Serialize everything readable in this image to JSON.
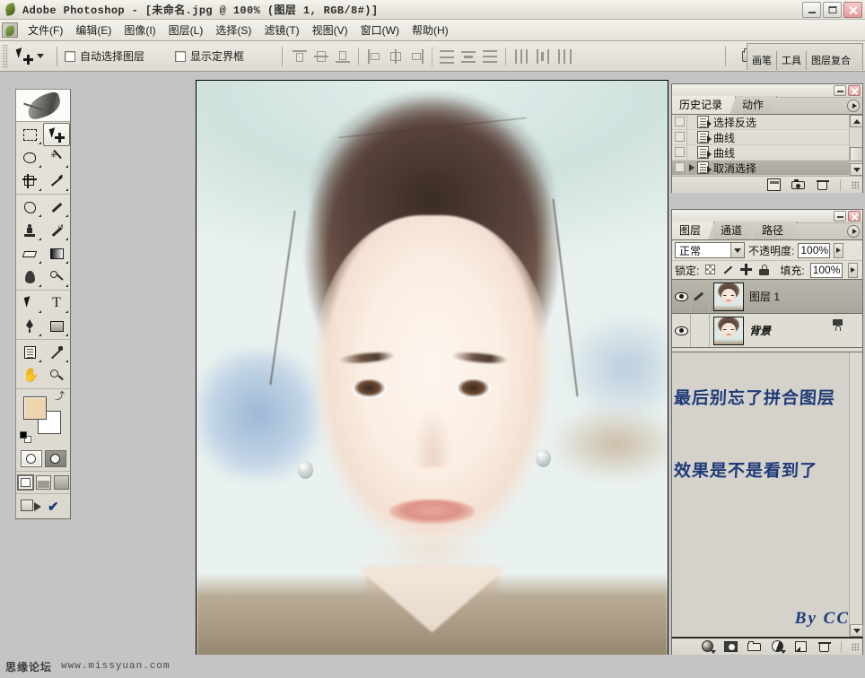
{
  "window": {
    "title": "Adobe Photoshop - [未命名.jpg @ 100% (图层 1, RGB/8#)]",
    "app_icon": "photoshop-feather-icon",
    "minimize_label": "最小化",
    "restore_label": "还原",
    "close_label": "关闭"
  },
  "menubar": {
    "doc_icon": "document-icon",
    "items": [
      {
        "label": "文件(F)"
      },
      {
        "label": "编辑(E)"
      },
      {
        "label": "图像(I)"
      },
      {
        "label": "图层(L)"
      },
      {
        "label": "选择(S)"
      },
      {
        "label": "滤镜(T)"
      },
      {
        "label": "视图(V)"
      },
      {
        "label": "窗口(W)"
      },
      {
        "label": "帮助(H)"
      }
    ]
  },
  "options_bar": {
    "tool_icon": "move-tool-icon",
    "checkboxes": [
      {
        "label": "自动选择图层",
        "checked": false
      },
      {
        "label": "显示定界框",
        "checked": false
      }
    ],
    "align_groups": [
      [
        "align-top-edges",
        "align-vertical-centers",
        "align-bottom-edges"
      ],
      [
        "align-left-edges",
        "align-horizontal-centers",
        "align-right-edges"
      ],
      [
        "distribute-top-edges",
        "distribute-vertical-centers",
        "distribute-bottom-edges"
      ],
      [
        "distribute-left-edges",
        "distribute-horizontal-centers",
        "distribute-right-edges"
      ]
    ],
    "file_browser_icon": "file-browser-icon",
    "palette_well": [
      {
        "label": "画笔"
      },
      {
        "label": "工具"
      },
      {
        "label": "图层复合"
      }
    ]
  },
  "toolbox": {
    "logo": "feather-logo",
    "tools": [
      {
        "name": "marquee-tool",
        "active": false
      },
      {
        "name": "move-tool",
        "active": true
      },
      {
        "name": "lasso-tool",
        "active": false
      },
      {
        "name": "magic-wand-tool",
        "active": false
      },
      {
        "name": "crop-tool",
        "active": false
      },
      {
        "name": "slice-tool",
        "active": false
      },
      {
        "name": "healing-brush-tool",
        "active": false
      },
      {
        "name": "brush-tool",
        "active": false
      },
      {
        "name": "clone-stamp-tool",
        "active": false
      },
      {
        "name": "history-brush-tool",
        "active": false
      },
      {
        "name": "eraser-tool",
        "active": false
      },
      {
        "name": "gradient-tool",
        "active": false
      },
      {
        "name": "blur-tool",
        "active": false
      },
      {
        "name": "dodge-tool",
        "active": false
      },
      {
        "name": "path-selection-tool",
        "active": false
      },
      {
        "name": "type-tool",
        "active": false
      },
      {
        "name": "pen-tool",
        "active": false
      },
      {
        "name": "rectangle-shape-tool",
        "active": false
      },
      {
        "name": "notes-tool",
        "active": false
      },
      {
        "name": "eyedropper-tool",
        "active": false
      },
      {
        "name": "hand-tool",
        "active": false
      },
      {
        "name": "zoom-tool",
        "active": false
      }
    ],
    "type_tool_glyph": "T",
    "colors": {
      "foreground": "#eed5b0",
      "background": "#ffffff",
      "swap_glyph": "⤴",
      "default_colors_label": "默认前景色和背景色"
    },
    "quick_mask": [
      {
        "name": "standard-mode",
        "selected": true
      },
      {
        "name": "quick-mask-mode",
        "selected": false
      }
    ],
    "screen_modes": [
      {
        "name": "standard-screen-mode",
        "selected": true
      },
      {
        "name": "full-screen-with-menubar-mode",
        "selected": false
      },
      {
        "name": "full-screen-mode",
        "selected": false
      }
    ],
    "jump_to": [
      {
        "name": "jump-to-imageready-button"
      },
      {
        "name": "check-mark-button"
      }
    ]
  },
  "history_palette": {
    "tabs": [
      {
        "label": "历史记录",
        "active": true
      },
      {
        "label": "动作",
        "active": false
      }
    ],
    "items": [
      {
        "label": "选择反选",
        "selected": false,
        "current": false
      },
      {
        "label": "曲线",
        "selected": false,
        "current": false
      },
      {
        "label": "曲线",
        "selected": false,
        "current": false
      },
      {
        "label": "取消选择",
        "selected": true,
        "current": true
      }
    ],
    "footer_icons": [
      "new-document-from-state-icon",
      "new-snapshot-icon",
      "delete-state-icon"
    ]
  },
  "layers_palette": {
    "tabs": [
      {
        "label": "图层",
        "active": true
      },
      {
        "label": "通道",
        "active": false
      },
      {
        "label": "路径",
        "active": false
      }
    ],
    "blend_mode": "正常",
    "opacity_label": "不透明度:",
    "opacity_value": "100%",
    "lock_label": "锁定:",
    "lock_icons": [
      "lock-transparent-pixels-icon",
      "lock-image-pixels-icon",
      "lock-position-icon",
      "lock-all-icon"
    ],
    "fill_label": "填充:",
    "fill_value": "100%",
    "layers": [
      {
        "name": "图层 1",
        "visible": true,
        "selected": true,
        "locked": false,
        "active_brush": true
      },
      {
        "name": "背景",
        "visible": true,
        "selected": false,
        "locked": true,
        "active_brush": false
      }
    ],
    "footer_icons": [
      "layer-style-icon",
      "layer-mask-icon",
      "new-group-icon",
      "new-adjustment-layer-icon",
      "new-layer-icon",
      "delete-layer-icon"
    ]
  },
  "annotations": {
    "line1": "最后别忘了拼合图层",
    "line2": "效果是不是看到了",
    "signature": "By CC",
    "color": "#1f3a78"
  },
  "document": {
    "canvas_name": "未命名.jpg",
    "zoom": "100%",
    "color_mode": "RGB/8#",
    "subject": "portrait-photo-retouched"
  },
  "watermark": {
    "forum": "思缘论坛",
    "url": "www.missyuan.com"
  }
}
